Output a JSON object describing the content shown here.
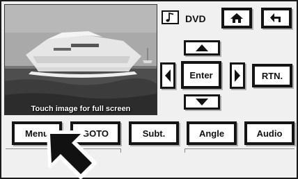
{
  "video": {
    "caption": "Touch image for full screen"
  },
  "header": {
    "source_label": "DVD",
    "icons": {
      "source": "music-note-icon",
      "home": "home-icon",
      "back": "return-arrow-icon"
    }
  },
  "nav": {
    "enter_label": "Enter",
    "return_label": "RTN.",
    "icons": {
      "up": "triangle-up-icon",
      "down": "triangle-down-icon",
      "left": "triangle-left-icon",
      "right": "triangle-right-icon"
    }
  },
  "bottom_bar": {
    "buttons": [
      {
        "label": "Menu"
      },
      {
        "label": "GOTO"
      },
      {
        "label": "Subt."
      },
      {
        "label": "Angle"
      },
      {
        "label": "Audio"
      }
    ]
  },
  "cursor": {
    "icon": "pointer-arrow-icon"
  }
}
